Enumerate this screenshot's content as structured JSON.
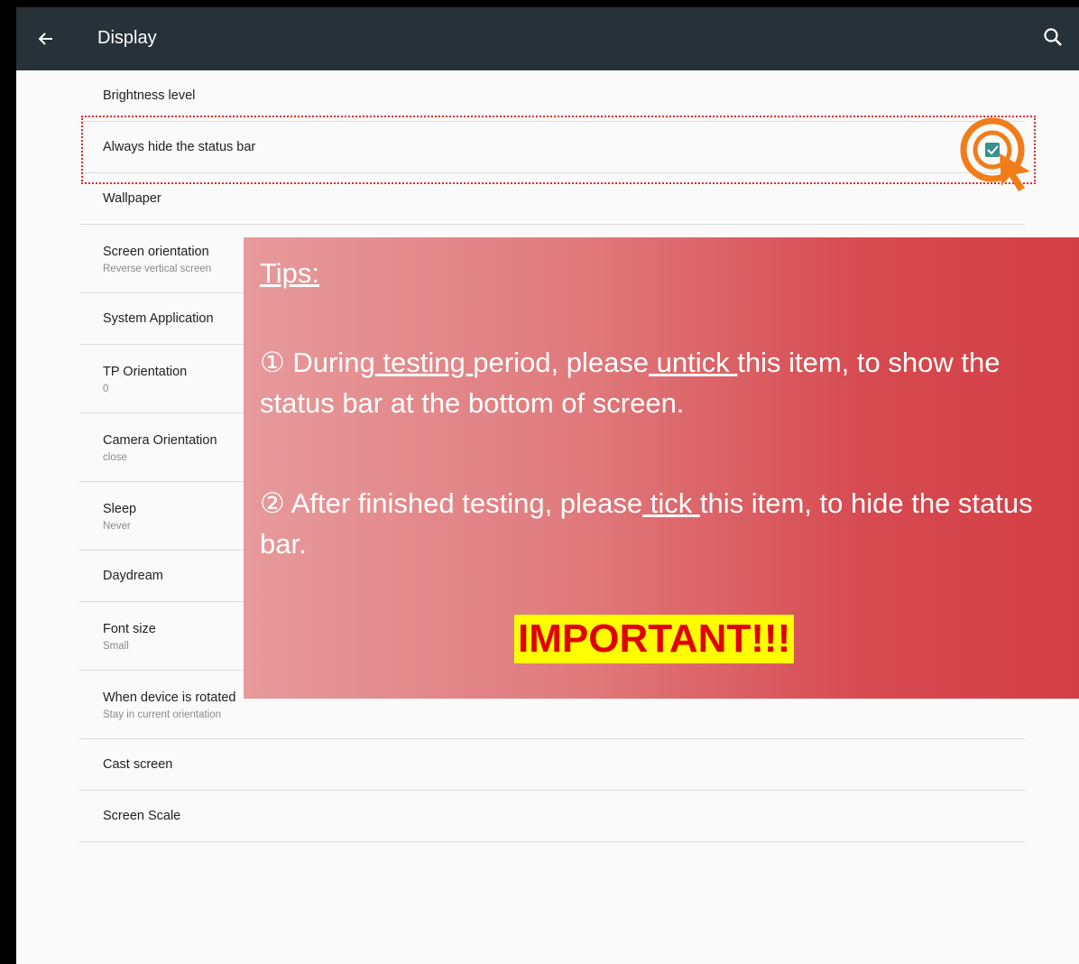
{
  "appbar": {
    "title": "Display",
    "back_icon": "arrow-left-icon",
    "search_icon": "search-icon",
    "background": "#263238"
  },
  "settings": [
    {
      "title": "Brightness level",
      "subtitle": ""
    },
    {
      "title": "Always hide the status bar",
      "subtitle": ""
    },
    {
      "title": "Wallpaper",
      "subtitle": ""
    },
    {
      "title": "Screen orientation",
      "subtitle": "Reverse vertical screen"
    },
    {
      "title": "System Application",
      "subtitle": ""
    },
    {
      "title": "TP Orientation",
      "subtitle": "0"
    },
    {
      "title": "Camera Orientation",
      "subtitle": "close"
    },
    {
      "title": "Sleep",
      "subtitle": "Never"
    },
    {
      "title": "Daydream",
      "subtitle": ""
    },
    {
      "title": "Font size",
      "subtitle": "Small"
    },
    {
      "title": "When device is rotated",
      "subtitle": "Stay in current orientation"
    },
    {
      "title": "Cast screen",
      "subtitle": ""
    },
    {
      "title": "Screen Scale",
      "subtitle": ""
    }
  ],
  "tips": {
    "title": "Tips:",
    "tip1": {
      "a": "① During",
      "b": " testing ",
      "c": "period, please",
      "d": " untick ",
      "e": "this item, to show the status bar at the bottom of screen."
    },
    "tip2": {
      "a": "② After finished testing, please",
      "b": " tick ",
      "c": "this item, to hide the status bar."
    },
    "important": "IMPORTANT!!!"
  },
  "colors": {
    "highlight_border": "#d32f2f",
    "target_orange": "#f07d1a",
    "important_bg": "#ffff00",
    "important_text": "#e00000"
  }
}
